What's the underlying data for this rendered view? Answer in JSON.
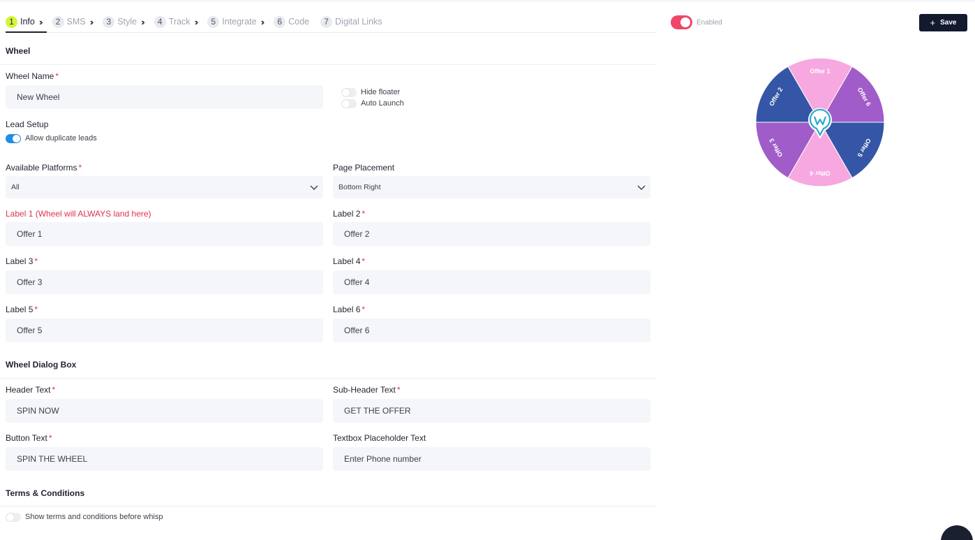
{
  "tabs": [
    {
      "num": "1",
      "label": "Info",
      "active": true
    },
    {
      "num": "2",
      "label": "SMS"
    },
    {
      "num": "3",
      "label": "Style"
    },
    {
      "num": "4",
      "label": "Track"
    },
    {
      "num": "5",
      "label": "Integrate"
    },
    {
      "num": "6",
      "label": "Code"
    },
    {
      "num": "7",
      "label": "Digital Links"
    }
  ],
  "tab_chevron": "››",
  "required_mark": "*",
  "wheel_section": {
    "title": "Wheel",
    "wheel_name_label": "Wheel Name",
    "wheel_name_value": "New Wheel",
    "hide_floater_label": "Hide floater",
    "auto_launch_label": "Auto Launch",
    "lead_setup_label": "Lead Setup",
    "allow_duplicate_label": "Allow duplicate leads",
    "platforms_label": "Available Platforms",
    "platforms_value": "All",
    "placement_label": "Page Placement",
    "placement_value": "Bottom Right",
    "label1_label": "Label 1 (Wheel will ALWAYS land here)",
    "label1_value": "Offer 1",
    "label2_label": "Label 2",
    "label2_value": "Offer 2",
    "label3_label": "Label 3",
    "label3_value": "Offer 3",
    "label4_label": "Label 4",
    "label4_value": "Offer 4",
    "label5_label": "Label 5",
    "label5_value": "Offer 5",
    "label6_label": "Label 6",
    "label6_value": "Offer 6"
  },
  "dialog_section": {
    "title": "Wheel Dialog Box",
    "header_label": "Header Text",
    "header_value": "SPIN NOW",
    "subheader_label": "Sub-Header Text",
    "subheader_value": "GET THE OFFER",
    "button_label": "Button Text",
    "button_value": "SPIN THE WHEEL",
    "placeholder_label": "Textbox Placeholder Text",
    "placeholder_value": "Enter Phone number"
  },
  "terms_section": {
    "title": "Terms & Conditions",
    "toggle_label": "Show terms and conditions before whisp"
  },
  "right_panel": {
    "enabled_label": "Enabled",
    "save_label": "Save",
    "wheel_slices": [
      {
        "label": "Offer 1",
        "color": "#f7a8e0"
      },
      {
        "label": "Offer 6",
        "color": "#a05cc8"
      },
      {
        "label": "Offer 5",
        "color": "#3556a6"
      },
      {
        "label": "Offer 4",
        "color": "#f7a8e0"
      },
      {
        "label": "Offer 3",
        "color": "#a05cc8"
      },
      {
        "label": "Offer 2",
        "color": "#3556a6"
      }
    ]
  },
  "colors": {
    "accent_red": "#e0314e",
    "toggle_on_blue": "#1c8fe8",
    "enabled_pink": "#f0456b",
    "active_tab": "#d4f53b",
    "save_bg": "#141a2e",
    "logo_teal": "#2aa8c8"
  }
}
